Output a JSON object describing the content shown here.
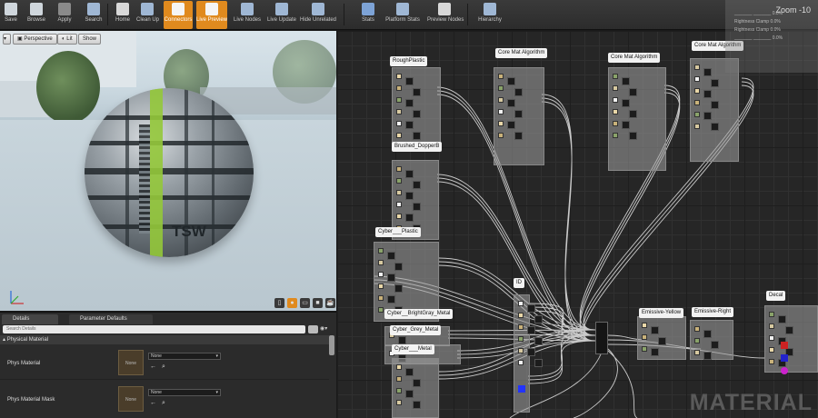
{
  "toolbar": {
    "items": [
      {
        "label": "Save",
        "icon": "save-icon"
      },
      {
        "label": "Browse",
        "icon": "browse-icon"
      },
      {
        "label": "Apply",
        "icon": "apply-icon"
      },
      {
        "label": "Search",
        "icon": "search-icon"
      },
      {
        "label": "Home",
        "icon": "home-icon"
      },
      {
        "label": "Clean Up",
        "icon": "clean-up-icon"
      },
      {
        "label": "Connectors",
        "icon": "connectors-icon"
      },
      {
        "label": "Live Preview",
        "icon": "live-preview-icon"
      },
      {
        "label": "Live Nodes",
        "icon": "live-nodes-icon"
      },
      {
        "label": "Live Update",
        "icon": "live-update-icon"
      },
      {
        "label": "Hide Unrelated",
        "icon": "hide-unrelated-icon"
      },
      {
        "label": "Stats",
        "icon": "stats-icon"
      },
      {
        "label": "Platform Stats",
        "icon": "platform-stats-icon"
      },
      {
        "label": "Preview Nodes",
        "icon": "preview-nodes-icon"
      },
      {
        "label": "Hierarchy",
        "icon": "hierarchy-icon"
      }
    ],
    "active": [
      "Connectors",
      "Live Preview"
    ],
    "accent": "#e08a1e"
  },
  "viewport": {
    "perspective_label": "Perspective",
    "lit_label": "Lit",
    "show_label": "Show",
    "sphere_text": "TSW",
    "preview_shape_icons": [
      "cylinder-icon",
      "sphere-icon",
      "plane-icon",
      "cube-icon",
      "teapot-icon"
    ]
  },
  "details": {
    "tabs": [
      {
        "label": "Details"
      },
      {
        "label": "Parameter Defaults"
      }
    ],
    "search_placeholder": "Search Details",
    "section": "Physical Material",
    "rows": [
      {
        "label": "Phys Material",
        "thumb_text": "None",
        "value": "None"
      },
      {
        "label": "Phys Material Mask",
        "thumb_text": "None",
        "value": "None"
      }
    ]
  },
  "graph": {
    "zoom": "Zoom -10",
    "watermark": "MATERIAL",
    "comments": [
      {
        "title": "RoughPlastic"
      },
      {
        "title": "Brushed_DopperB"
      },
      {
        "title": "Cyber___Plastic"
      },
      {
        "title": "Cyber__BrightGray_Metal"
      },
      {
        "title": "Cyber_Grey_Metal"
      },
      {
        "title": "Cyber___Metal"
      },
      {
        "title": "Core Mat Algorithm"
      },
      {
        "title": "Core Mat Algorithm"
      },
      {
        "title": "Core Mat Algorithm"
      },
      {
        "title": "ID"
      },
      {
        "title": "Emissive-Yellow"
      },
      {
        "title": "Emissive-Right"
      },
      {
        "title": "Decal"
      }
    ],
    "overlay_stats": [
      "_______  _______  0.0%",
      "Rightness Clamp  0.0%",
      "Rightness Clamp  0.0%",
      "_______  _______  0.0%"
    ]
  }
}
